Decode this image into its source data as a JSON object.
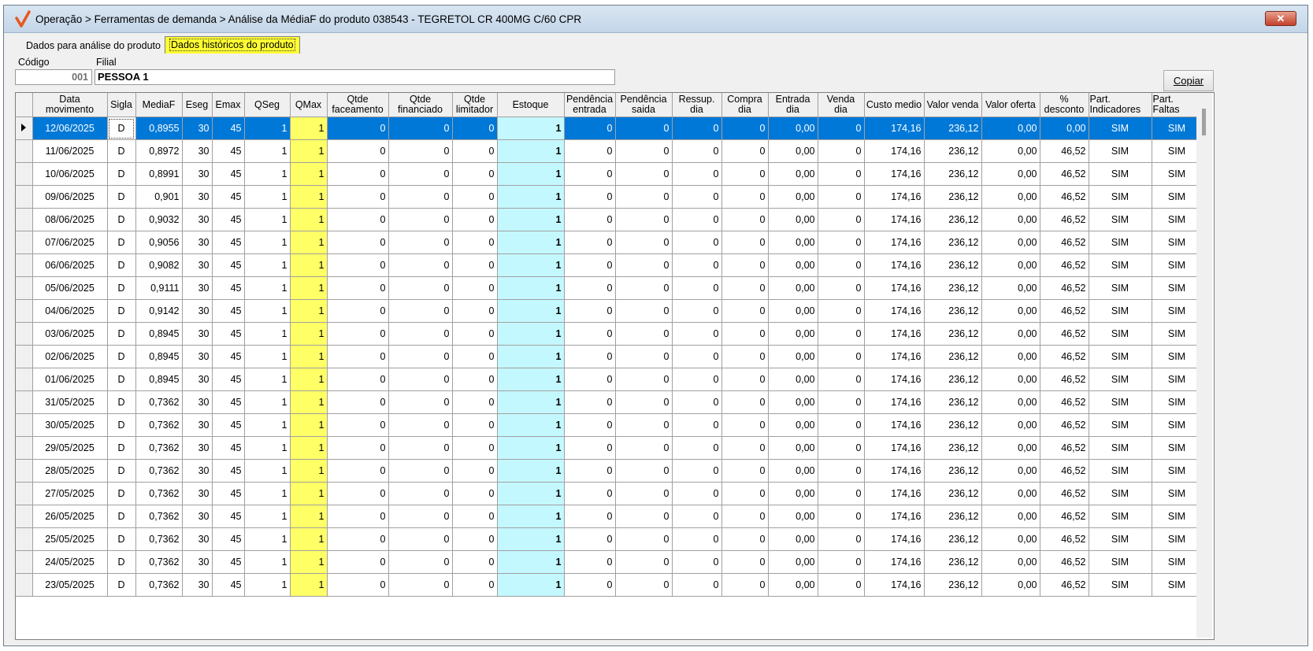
{
  "window": {
    "title": "Operação > Ferramentas de demanda > Análise da MédiaF do produto 038543 - TEGRETOL CR 400MG C/60 CPR",
    "close_glyph": "✕"
  },
  "tabs": [
    {
      "label": "Dados para análise do produto",
      "active": false
    },
    {
      "label": "Dados históricos do produto",
      "active": true
    }
  ],
  "form": {
    "codigo_label": "Código",
    "codigo_value": "001",
    "filial_label": "Filial",
    "filial_value": "PESSOA 1",
    "copy_button": "Copiar"
  },
  "grid": {
    "columns": [
      "Data\nmovimento",
      "Sigla",
      "MediaF",
      "Eseg",
      "Emax",
      "QSeg",
      "QMax",
      "Qtde\nfaceamento",
      "Qtde\nfinanciado",
      "Qtde\nlimitador",
      "Estoque",
      "Pendência\nentrada",
      "Pendência\nsaida",
      "Ressup.\ndia",
      "Compra\ndia",
      "Entrada\ndia",
      "Venda\ndia",
      "Custo medio",
      "Valor venda",
      "Valor oferta",
      "%\ndesconto",
      "Part.\nIndicadores",
      "Part.\nFaltas"
    ],
    "rows": [
      [
        "12/06/2025",
        "D",
        "0,8955",
        "30",
        "45",
        "1",
        "1",
        "0",
        "0",
        "0",
        "1",
        "0",
        "0",
        "0",
        "0",
        "0,00",
        "0",
        "174,16",
        "236,12",
        "0,00",
        "0,00",
        "SIM",
        "SIM"
      ],
      [
        "11/06/2025",
        "D",
        "0,8972",
        "30",
        "45",
        "1",
        "1",
        "0",
        "0",
        "0",
        "1",
        "0",
        "0",
        "0",
        "0",
        "0,00",
        "0",
        "174,16",
        "236,12",
        "0,00",
        "46,52",
        "SIM",
        "SIM"
      ],
      [
        "10/06/2025",
        "D",
        "0,8991",
        "30",
        "45",
        "1",
        "1",
        "0",
        "0",
        "0",
        "1",
        "0",
        "0",
        "0",
        "0",
        "0,00",
        "0",
        "174,16",
        "236,12",
        "0,00",
        "46,52",
        "SIM",
        "SIM"
      ],
      [
        "09/06/2025",
        "D",
        "0,901",
        "30",
        "45",
        "1",
        "1",
        "0",
        "0",
        "0",
        "1",
        "0",
        "0",
        "0",
        "0",
        "0,00",
        "0",
        "174,16",
        "236,12",
        "0,00",
        "46,52",
        "SIM",
        "SIM"
      ],
      [
        "08/06/2025",
        "D",
        "0,9032",
        "30",
        "45",
        "1",
        "1",
        "0",
        "0",
        "0",
        "1",
        "0",
        "0",
        "0",
        "0",
        "0,00",
        "0",
        "174,16",
        "236,12",
        "0,00",
        "46,52",
        "SIM",
        "SIM"
      ],
      [
        "07/06/2025",
        "D",
        "0,9056",
        "30",
        "45",
        "1",
        "1",
        "0",
        "0",
        "0",
        "1",
        "0",
        "0",
        "0",
        "0",
        "0,00",
        "0",
        "174,16",
        "236,12",
        "0,00",
        "46,52",
        "SIM",
        "SIM"
      ],
      [
        "06/06/2025",
        "D",
        "0,9082",
        "30",
        "45",
        "1",
        "1",
        "0",
        "0",
        "0",
        "1",
        "0",
        "0",
        "0",
        "0",
        "0,00",
        "0",
        "174,16",
        "236,12",
        "0,00",
        "46,52",
        "SIM",
        "SIM"
      ],
      [
        "05/06/2025",
        "D",
        "0,9111",
        "30",
        "45",
        "1",
        "1",
        "0",
        "0",
        "0",
        "1",
        "0",
        "0",
        "0",
        "0",
        "0,00",
        "0",
        "174,16",
        "236,12",
        "0,00",
        "46,52",
        "SIM",
        "SIM"
      ],
      [
        "04/06/2025",
        "D",
        "0,9142",
        "30",
        "45",
        "1",
        "1",
        "0",
        "0",
        "0",
        "1",
        "0",
        "0",
        "0",
        "0",
        "0,00",
        "0",
        "174,16",
        "236,12",
        "0,00",
        "46,52",
        "SIM",
        "SIM"
      ],
      [
        "03/06/2025",
        "D",
        "0,8945",
        "30",
        "45",
        "1",
        "1",
        "0",
        "0",
        "0",
        "1",
        "0",
        "0",
        "0",
        "0",
        "0,00",
        "0",
        "174,16",
        "236,12",
        "0,00",
        "46,52",
        "SIM",
        "SIM"
      ],
      [
        "02/06/2025",
        "D",
        "0,8945",
        "30",
        "45",
        "1",
        "1",
        "0",
        "0",
        "0",
        "1",
        "0",
        "0",
        "0",
        "0",
        "0,00",
        "0",
        "174,16",
        "236,12",
        "0,00",
        "46,52",
        "SIM",
        "SIM"
      ],
      [
        "01/06/2025",
        "D",
        "0,8945",
        "30",
        "45",
        "1",
        "1",
        "0",
        "0",
        "0",
        "1",
        "0",
        "0",
        "0",
        "0",
        "0,00",
        "0",
        "174,16",
        "236,12",
        "0,00",
        "46,52",
        "SIM",
        "SIM"
      ],
      [
        "31/05/2025",
        "D",
        "0,7362",
        "30",
        "45",
        "1",
        "1",
        "0",
        "0",
        "0",
        "1",
        "0",
        "0",
        "0",
        "0",
        "0,00",
        "0",
        "174,16",
        "236,12",
        "0,00",
        "46,52",
        "SIM",
        "SIM"
      ],
      [
        "30/05/2025",
        "D",
        "0,7362",
        "30",
        "45",
        "1",
        "1",
        "0",
        "0",
        "0",
        "1",
        "0",
        "0",
        "0",
        "0",
        "0,00",
        "0",
        "174,16",
        "236,12",
        "0,00",
        "46,52",
        "SIM",
        "SIM"
      ],
      [
        "29/05/2025",
        "D",
        "0,7362",
        "30",
        "45",
        "1",
        "1",
        "0",
        "0",
        "0",
        "1",
        "0",
        "0",
        "0",
        "0",
        "0,00",
        "0",
        "174,16",
        "236,12",
        "0,00",
        "46,52",
        "SIM",
        "SIM"
      ],
      [
        "28/05/2025",
        "D",
        "0,7362",
        "30",
        "45",
        "1",
        "1",
        "0",
        "0",
        "0",
        "1",
        "0",
        "0",
        "0",
        "0",
        "0,00",
        "0",
        "174,16",
        "236,12",
        "0,00",
        "46,52",
        "SIM",
        "SIM"
      ],
      [
        "27/05/2025",
        "D",
        "0,7362",
        "30",
        "45",
        "1",
        "1",
        "0",
        "0",
        "0",
        "1",
        "0",
        "0",
        "0",
        "0",
        "0,00",
        "0",
        "174,16",
        "236,12",
        "0,00",
        "46,52",
        "SIM",
        "SIM"
      ],
      [
        "26/05/2025",
        "D",
        "0,7362",
        "30",
        "45",
        "1",
        "1",
        "0",
        "0",
        "0",
        "1",
        "0",
        "0",
        "0",
        "0",
        "0,00",
        "0",
        "174,16",
        "236,12",
        "0,00",
        "46,52",
        "SIM",
        "SIM"
      ],
      [
        "25/05/2025",
        "D",
        "0,7362",
        "30",
        "45",
        "1",
        "1",
        "0",
        "0",
        "0",
        "1",
        "0",
        "0",
        "0",
        "0",
        "0,00",
        "0",
        "174,16",
        "236,12",
        "0,00",
        "46,52",
        "SIM",
        "SIM"
      ],
      [
        "24/05/2025",
        "D",
        "0,7362",
        "30",
        "45",
        "1",
        "1",
        "0",
        "0",
        "0",
        "1",
        "0",
        "0",
        "0",
        "0",
        "0,00",
        "0",
        "174,16",
        "236,12",
        "0,00",
        "46,52",
        "SIM",
        "SIM"
      ],
      [
        "23/05/2025",
        "D",
        "0,7362",
        "30",
        "45",
        "1",
        "1",
        "0",
        "0",
        "0",
        "1",
        "0",
        "0",
        "0",
        "0",
        "0,00",
        "0",
        "174,16",
        "236,12",
        "0,00",
        "46,52",
        "SIM",
        "SIM"
      ]
    ],
    "selected_row": 0
  },
  "colors": {
    "selection": "#0078d7",
    "qmax_highlight": "#ffff66",
    "estoque_highlight": "#c4f8ff",
    "active_tab": "#ffff33"
  }
}
